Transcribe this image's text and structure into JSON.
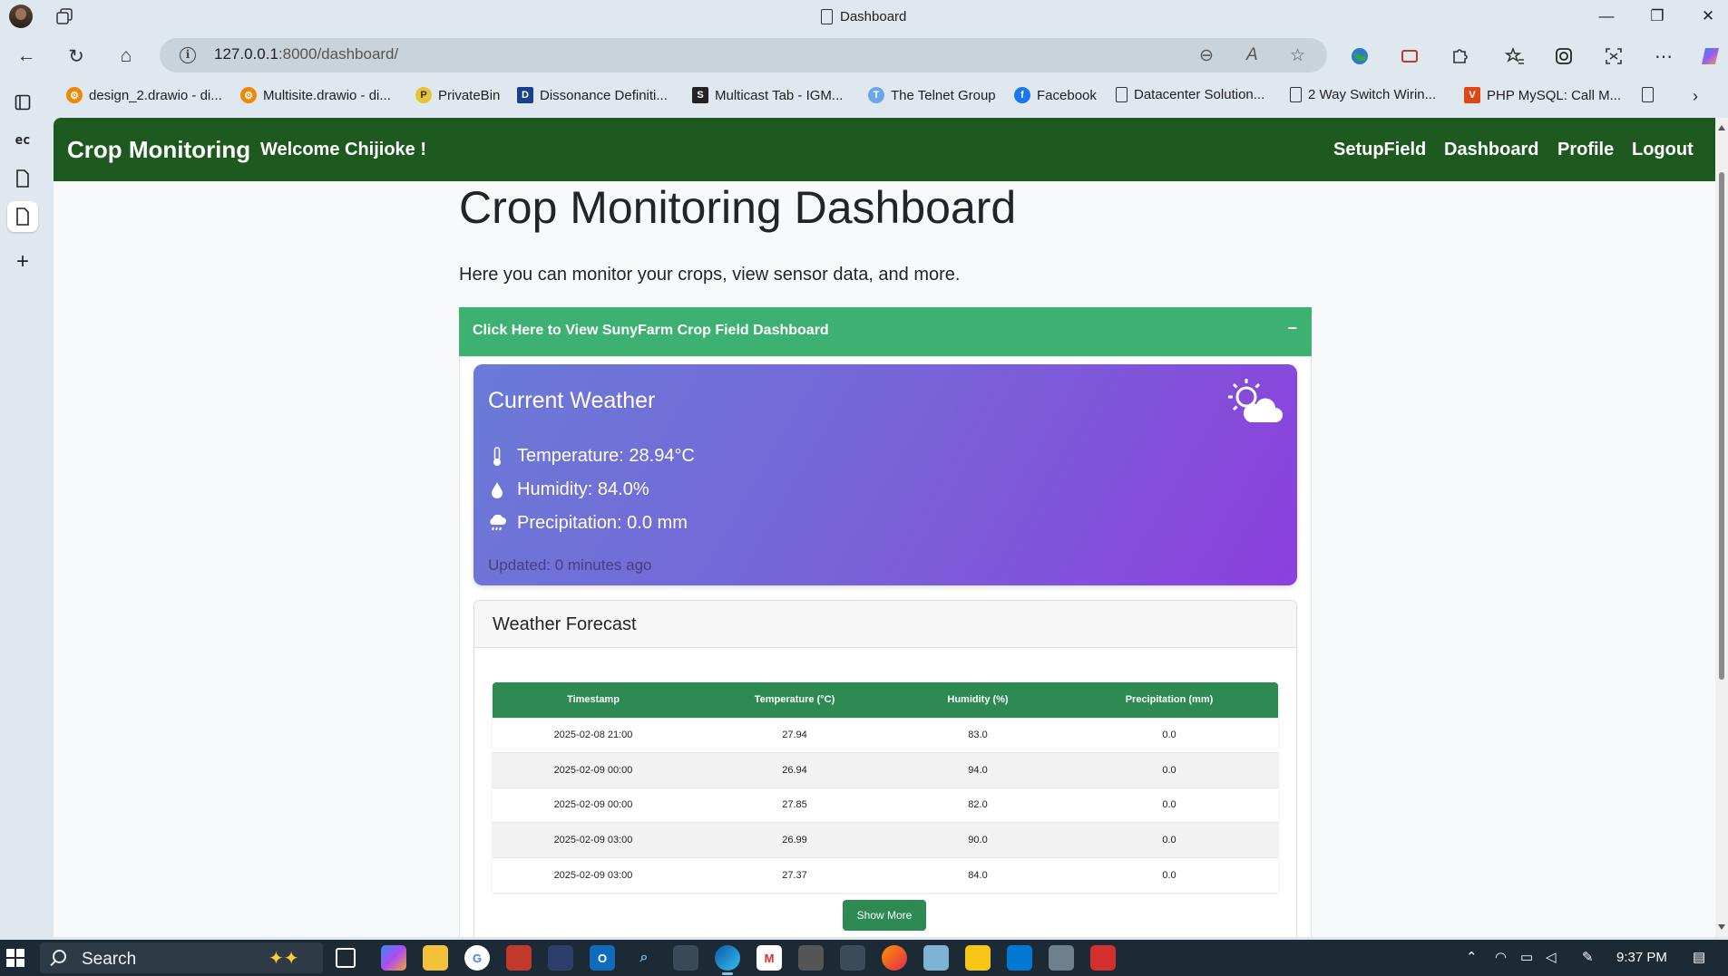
{
  "window": {
    "title": "Dashboard",
    "controls": {
      "minimize": "—",
      "restore": "❐",
      "close": "✕"
    }
  },
  "toolbar": {
    "url_host": "127.0.0.1",
    "url_rest": ":8000/dashboard/",
    "info_glyph": "i",
    "back_glyph": "←",
    "reload_glyph": "↻",
    "home_glyph": "⌂",
    "zoom_glyph": "⊖",
    "read_aloud_glyph": "A",
    "favorite_glyph": "☆",
    "more_glyph": "⋯"
  },
  "bookmarks": [
    {
      "label": "design_2.drawio - di...",
      "icon": "drawio-icon",
      "color": "#f08705",
      "glyph": "⚙"
    },
    {
      "label": "Multisite.drawio - di...",
      "icon": "drawio-icon",
      "color": "#f08705",
      "glyph": "⚙"
    },
    {
      "label": "PrivateBin",
      "icon": "privatebin-icon",
      "color": "#e8c33a",
      "glyph": "P"
    },
    {
      "label": "Dissonance Definiti...",
      "icon": "dictionary-icon",
      "color": "#1c3f8c",
      "glyph": "D"
    },
    {
      "label": "Multicast Tab - IGM...",
      "icon": "scribd-icon",
      "color": "#222222",
      "glyph": "S"
    },
    {
      "label": "The Telnet Group",
      "icon": "telnet-icon",
      "color": "#6aa6e8",
      "glyph": "T"
    },
    {
      "label": "Facebook",
      "icon": "facebook-icon",
      "color": "#1877f2",
      "glyph": "f"
    },
    {
      "label": "Datacenter Solution...",
      "icon": "page-icon",
      "color": "#dfe8ee",
      "glyph": ""
    },
    {
      "label": "2 Way Switch Wirin...",
      "icon": "page-icon",
      "color": "#dfe8ee",
      "glyph": ""
    },
    {
      "label": "PHP MySQL: Call M...",
      "icon": "codeigniter-icon",
      "color": "#dd4814",
      "glyph": "V"
    }
  ],
  "navbar": {
    "brand": "Crop Monitoring",
    "welcome": "Welcome Chijioke !",
    "links": [
      "SetupField",
      "Dashboard",
      "Profile",
      "Logout"
    ]
  },
  "page": {
    "title": "Crop Monitoring Dashboard",
    "lead": "Here you can monitor your crops, view sensor data, and more.",
    "accordion_label": "Click Here to View SunyFarm Crop Field Dashboard",
    "accordion_toggle": "−"
  },
  "weather": {
    "title": "Current Weather",
    "temperature": "Temperature: 28.94°C",
    "humidity": "Humidity: 84.0%",
    "precipitation": "Precipitation: 0.0 mm",
    "updated": "Updated: 0 minutes ago"
  },
  "forecast": {
    "title": "Weather Forecast",
    "columns": [
      "Timestamp",
      "Temperature (°C)",
      "Humidity (%)",
      "Precipitation (mm)"
    ],
    "rows": [
      [
        "2025-02-08 21:00",
        "27.94",
        "83.0",
        "0.0"
      ],
      [
        "2025-02-09 00:00",
        "26.94",
        "94.0",
        "0.0"
      ],
      [
        "2025-02-09 00:00",
        "27.85",
        "82.0",
        "0.0"
      ],
      [
        "2025-02-09 03:00",
        "26.99",
        "90.0",
        "0.0"
      ],
      [
        "2025-02-09 03:00",
        "27.37",
        "84.0",
        "0.0"
      ]
    ],
    "show_more": "Show More"
  },
  "taskbar": {
    "search_label": "Search",
    "time": "9:37 PM"
  },
  "colors": {
    "navbar": "#1e5a1f",
    "accordion": "#3db171",
    "table_header": "#2e8a53",
    "weather_gradient_start": "#6a7bd6",
    "weather_gradient_end": "#8c3fdc"
  }
}
